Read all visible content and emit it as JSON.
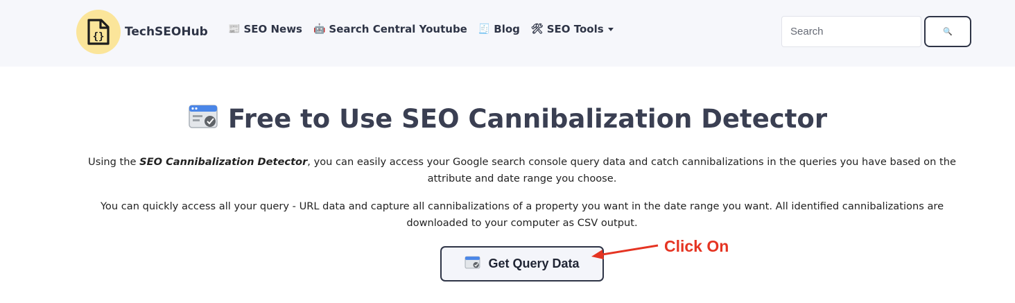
{
  "brand": {
    "name": "TechSEOHub"
  },
  "nav": {
    "items": [
      {
        "label": "SEO News",
        "icon": "newspaper-icon"
      },
      {
        "label": "Search Central Youtube",
        "icon": "robot-icon"
      },
      {
        "label": "Blog",
        "icon": "receipt-icon"
      },
      {
        "label": "SEO Tools",
        "icon": "tools-icon",
        "dropdown": true
      }
    ]
  },
  "search": {
    "placeholder": "Search",
    "value": ""
  },
  "main": {
    "title": "Free to Use SEO Cannibalization Detector",
    "para1_prefix": "Using the ",
    "para1_emphasis": "SEO Cannibalization Detector",
    "para1_suffix": ", you can easily access your Google search console query data and catch cannibalizations in the queries you have based on the attribute and date range you choose.",
    "para2": "You can quickly access all your query - URL data and capture all cannibalizations of a property you want in the date range you want. All identified cannibalizations are downloaded to your computer as CSV output.",
    "cta_label": "Get Query Data"
  },
  "annotation": {
    "text": "Click On",
    "color": "#e53422"
  },
  "colors": {
    "navbar_bg": "#f6f7fb",
    "logo_bg": "#fbe59a",
    "text_dark": "#2e3446"
  }
}
